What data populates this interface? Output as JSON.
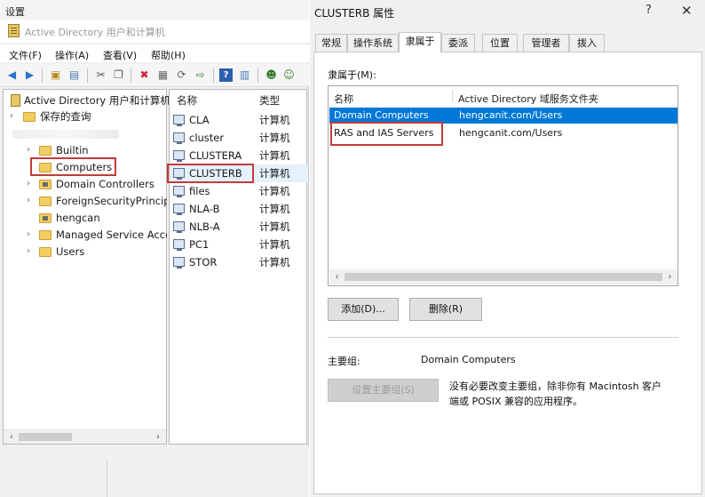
{
  "settings_title": "设置",
  "aduc": {
    "window_title": "Active Directory 用户和计算机",
    "menu": [
      "文件(F)",
      "操作(A)",
      "查看(V)",
      "帮助(H)"
    ],
    "tree": {
      "root": "Active Directory 用户和计算机",
      "saved_queries": "保存的查询",
      "items": [
        {
          "label": "Builtin"
        },
        {
          "label": "Computers"
        },
        {
          "label": "Domain Controllers"
        },
        {
          "label": "ForeignSecurityPrincipals"
        },
        {
          "label": "hengcan"
        },
        {
          "label": "Managed Service Accounts"
        },
        {
          "label": "Users"
        }
      ]
    },
    "list": {
      "col_name": "名称",
      "col_type": "类型",
      "rows": [
        {
          "name": "CLA",
          "type": "计算机"
        },
        {
          "name": "cluster",
          "type": "计算机"
        },
        {
          "name": "CLUSTERA",
          "type": "计算机"
        },
        {
          "name": "CLUSTERB",
          "type": "计算机"
        },
        {
          "name": "files",
          "type": "计算机"
        },
        {
          "name": "NLA-B",
          "type": "计算机"
        },
        {
          "name": "NLB-A",
          "type": "计算机"
        },
        {
          "name": "PC1",
          "type": "计算机"
        },
        {
          "name": "STOR",
          "type": "计算机"
        }
      ]
    }
  },
  "props": {
    "title": "CLUSTERB 属性",
    "help": "?",
    "close": "✕",
    "tabs": [
      "常规",
      "操作系统",
      "隶属于",
      "委派",
      "位置",
      "管理者",
      "拨入"
    ],
    "active_tab": "隶属于",
    "member_of_label": "隶属于(M):",
    "list_col_name": "名称",
    "list_col_folder": "Active Directory 域服务文件夹",
    "rows": [
      {
        "name": "Domain Computers",
        "folder": "hengcanit.com/Users",
        "selected": true
      },
      {
        "name": "RAS and IAS Servers",
        "folder": "hengcanit.com/Users",
        "selected": false
      }
    ],
    "add_button": "添加(D)...",
    "remove_button": "删除(R)",
    "primary_group_label": "主要组:",
    "primary_group_value": "Domain Computers",
    "set_primary_button": "设置主要组(S)",
    "note_line1": "没有必要改变主要组，除非你有 Macintosh 客户",
    "note_line2": "端或 POSIX 兼容的应用程序。"
  },
  "colors": {
    "selection": "#0078d7",
    "highlight": "#c23b3b"
  }
}
